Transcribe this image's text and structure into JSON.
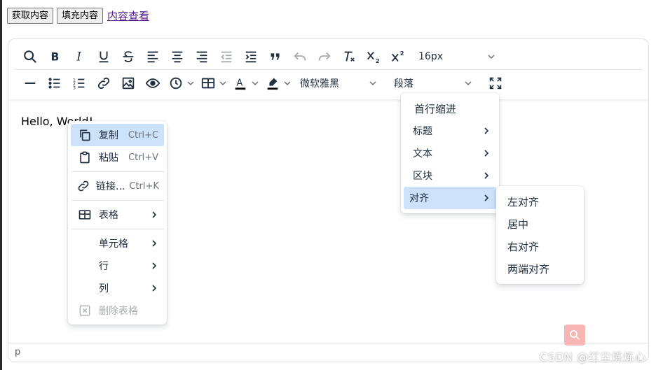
{
  "topbar": {
    "get_content_label": "获取内容",
    "fill_content_label": "填充内容",
    "view_content_link": "内容查看"
  },
  "toolbar": {
    "row1": [
      "search-icon",
      "bold-icon",
      "italic-icon",
      "underline-icon",
      "strikethrough-icon",
      "align-left-icon",
      "align-center-icon",
      "align-right-icon",
      "outdent-icon",
      "indent-icon",
      "blockquote-icon",
      "undo-icon",
      "redo-icon",
      "remove-format-icon",
      "subscript-icon",
      "superscript-icon"
    ],
    "font_size": "16px",
    "font_family": "微软雅黑",
    "block_format": "段落"
  },
  "content": {
    "text": "Hello, World!"
  },
  "statusbar": {
    "path": "p"
  },
  "context_menu": {
    "copy": {
      "label": "复制",
      "shortcut": "Ctrl+C"
    },
    "paste": {
      "label": "粘贴",
      "shortcut": "Ctrl+V"
    },
    "link": {
      "label": "链接...",
      "shortcut": "Ctrl+K"
    },
    "table": {
      "label": "表格"
    },
    "cell": {
      "label": "单元格"
    },
    "row": {
      "label": "行"
    },
    "column": {
      "label": "列"
    },
    "delete_table": {
      "label": "删除表格"
    }
  },
  "format_menu": {
    "first_line_indent": "首行缩进",
    "heading": "标题",
    "text": "文本",
    "block": "区块",
    "align": "对齐"
  },
  "align_menu": {
    "left": "左对齐",
    "center": "居中",
    "right": "右对齐",
    "justify": "两端对齐"
  },
  "watermark": "CSDN @红尘炼炼心",
  "colors": {
    "accent_bg": "#cce2fa",
    "text": "#222f3e",
    "disabled": "#a8aeb4"
  }
}
